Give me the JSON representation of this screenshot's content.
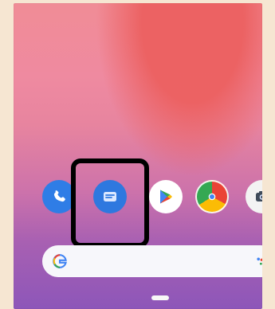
{
  "screen": {
    "dock_apps": [
      {
        "name": "phone",
        "icon": "phone-icon"
      },
      {
        "name": "messages",
        "icon": "message-icon"
      },
      {
        "name": "play-store",
        "icon": "play-store-icon"
      },
      {
        "name": "chrome",
        "icon": "chrome-icon"
      },
      {
        "name": "camera",
        "icon": "camera-icon"
      }
    ],
    "search": {
      "g_label": "G"
    },
    "navigation": {
      "handle": "home-handle"
    },
    "highlight": {
      "target": "messages-app"
    },
    "colors": {
      "wallpaper_top": "#f08c96",
      "wallpaper_bottom": "#8d56b9",
      "accent_blue": "#2e78df",
      "search_bg": "#f7f7fb",
      "highlight": "#000000"
    }
  }
}
